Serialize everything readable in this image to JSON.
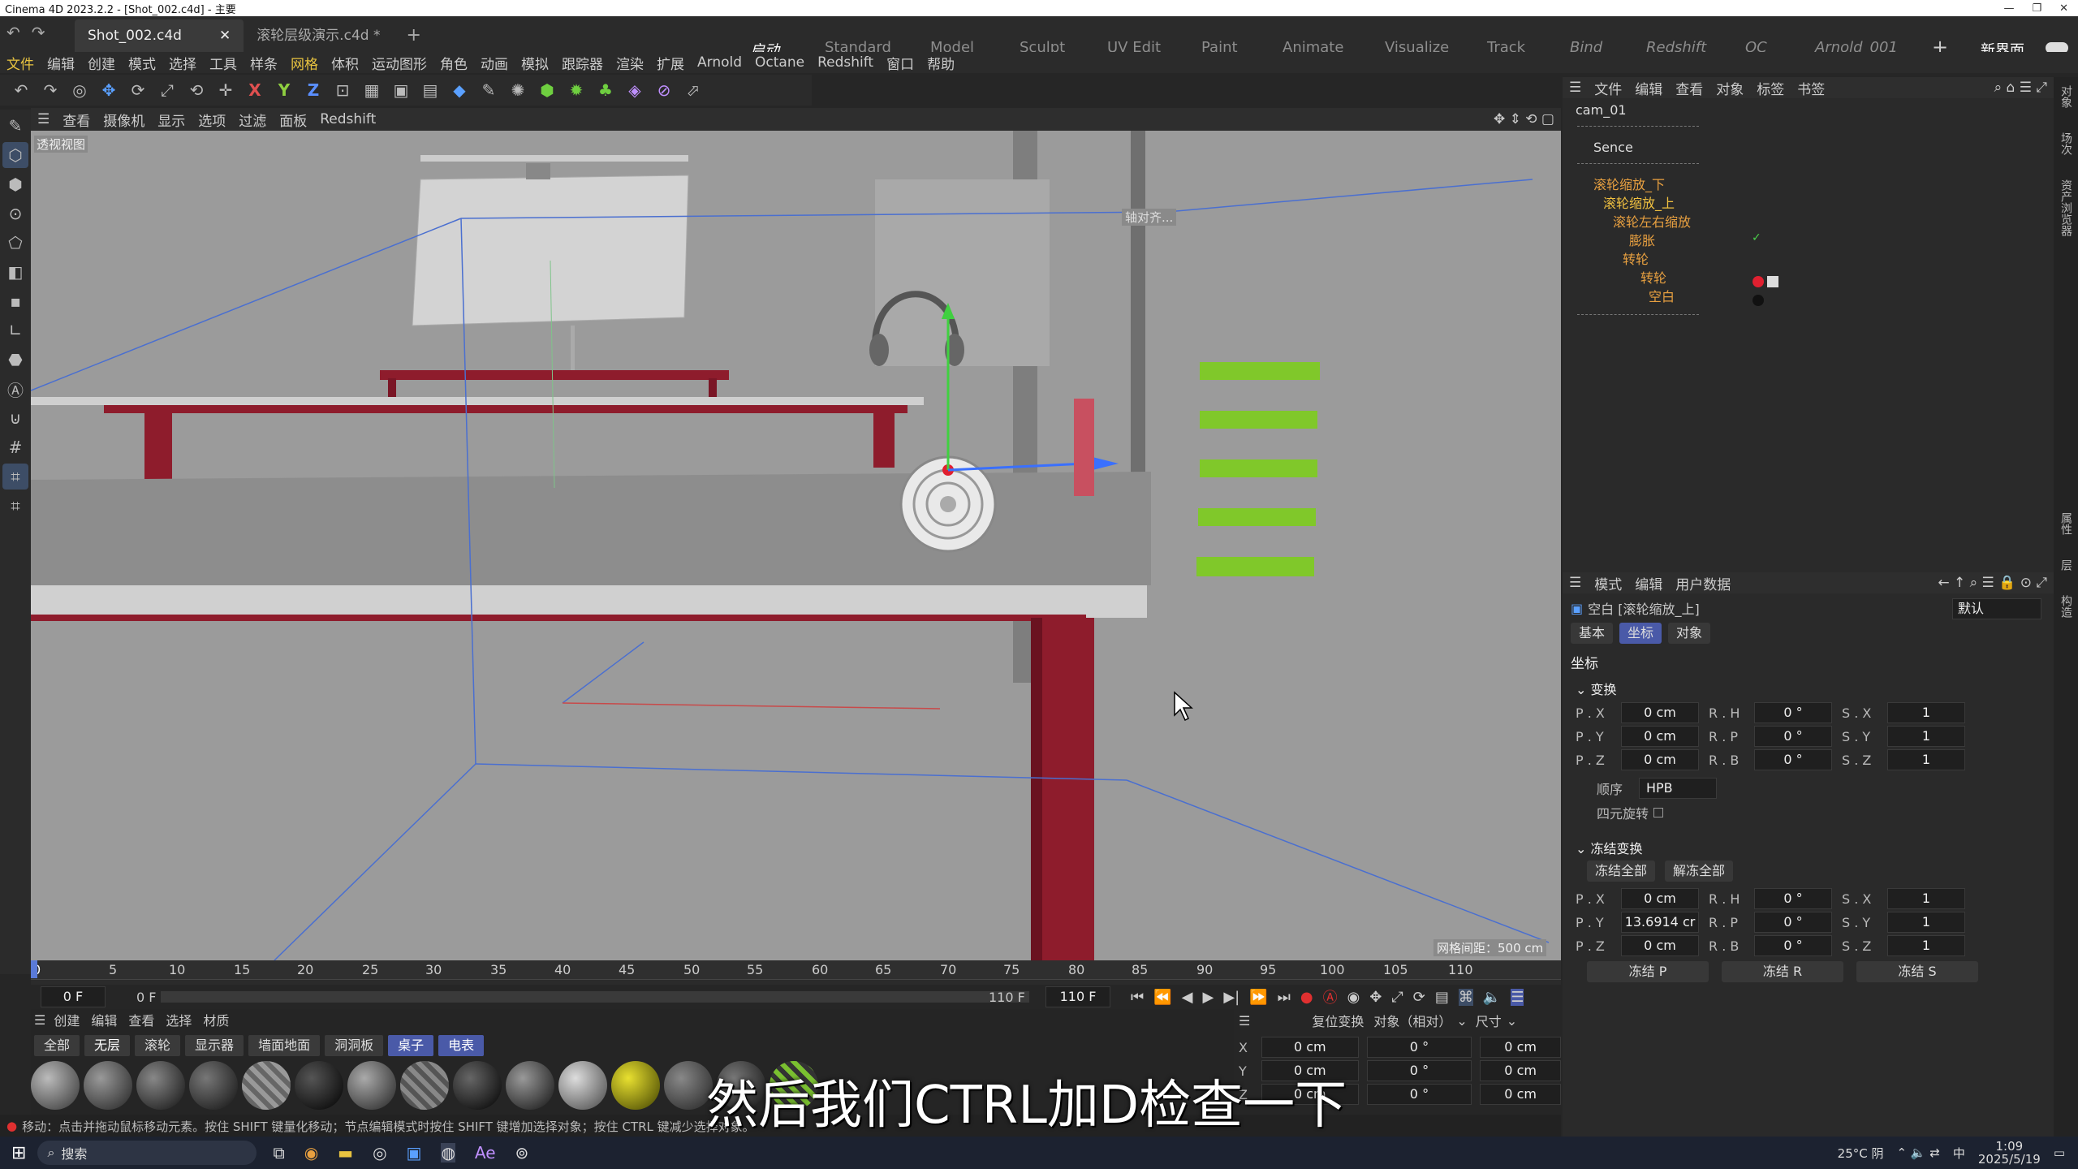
{
  "window": {
    "title": "Cinema 4D 2023.2.2 - [Shot_002.c4d] - 主要"
  },
  "tabs": [
    {
      "label": "Shot_002.c4d"
    },
    {
      "label": "滚轮层级演示.c4d *"
    }
  ],
  "new_tab": "+",
  "layouts": [
    "启动",
    "Standard",
    "Model",
    "Sculpt",
    "UV Edit",
    "Paint",
    "Animate",
    "Visualize",
    "Track",
    "Bind",
    "Redshift",
    "OC",
    "Arnold_001"
  ],
  "new_interface": "新界面",
  "menu": [
    "文件",
    "编辑",
    "创建",
    "模式",
    "选择",
    "工具",
    "样条",
    "网格",
    "体积",
    "运动图形",
    "角色",
    "动画",
    "模拟",
    "跟踪器",
    "渲染",
    "扩展",
    "Arnold",
    "Octane",
    "Redshift",
    "窗口",
    "帮助"
  ],
  "viewport_menu": [
    "查看",
    "摄像机",
    "显示",
    "选项",
    "过滤",
    "面板",
    "Redshift"
  ],
  "viewport": {
    "label": "透视视图",
    "grid_info": "网格间距：500 cm",
    "axis_tag": "轴对齐..."
  },
  "timeline": {
    "ticks": [
      "0",
      "5",
      "10",
      "15",
      "20",
      "25",
      "30",
      "35",
      "40",
      "45",
      "50",
      "55",
      "60",
      "65",
      "70",
      "75",
      "80",
      "85",
      "90",
      "95",
      "100",
      "105",
      "110"
    ],
    "current_frame": "0 F",
    "start": "0 F",
    "min": "0 F",
    "end": "110 F",
    "max": "110 F",
    "right_frame": "0 F"
  },
  "material_menu": [
    "创建",
    "编辑",
    "查看",
    "选择",
    "材质"
  ],
  "material_tabs": [
    "全部",
    "无层",
    "滚轮",
    "显示器",
    "墙面地面",
    "洞洞板",
    "桌子",
    "电表"
  ],
  "coord_panel": {
    "reset": "复位变换",
    "mode": "对象（相对）",
    "size": "尺寸",
    "rows": [
      {
        "axis": "X",
        "pos": "0 cm",
        "rot": "0 °",
        "size": "0 cm"
      },
      {
        "axis": "Y",
        "pos": "0 cm",
        "rot": "0 °",
        "size": "0 cm"
      },
      {
        "axis": "Z",
        "pos": "0 cm",
        "rot": "0 °",
        "size": "0 cm"
      }
    ]
  },
  "status": "移动：点击并拖动鼠标移动元素。按住 SHIFT 键量化移动；节点编辑模式时按住 SHIFT 键增加选择对象；按住 CTRL 键减少选择对象。",
  "subtitle": "然后我们CTRL加D检查一下",
  "object_manager": {
    "menu": [
      "文件",
      "编辑",
      "查看",
      "对象",
      "标签",
      "书签"
    ],
    "objects": [
      {
        "name": "cam_01",
        "style": "white"
      },
      {
        "name": "Sence",
        "style": "white"
      },
      {
        "name": "滚轮缩放_下",
        "style": "orange"
      },
      {
        "name": "滚轮缩放_上",
        "style": "sel"
      },
      {
        "name": "滚轮左右缩放",
        "style": "orange"
      },
      {
        "name": "膨胀",
        "style": "orange"
      },
      {
        "name": "转轮",
        "style": "orange"
      },
      {
        "name": "转轮",
        "style": "orange"
      },
      {
        "name": "空白",
        "style": "orange"
      }
    ]
  },
  "attributes": {
    "menu": [
      "模式",
      "编辑",
      "用户数据"
    ],
    "object_title": "空白 [滚轮缩放_上]",
    "preset": "默认",
    "tabs": [
      "基本",
      "坐标",
      "对象"
    ],
    "section": "坐标",
    "transform_group": "变换",
    "transform": [
      {
        "p": "P . X",
        "pv": "0 cm",
        "r": "R . H",
        "rv": "0 °",
        "s": "S . X",
        "sv": "1"
      },
      {
        "p": "P . Y",
        "pv": "0 cm",
        "r": "R . P",
        "rv": "0 °",
        "s": "S . Y",
        "sv": "1"
      },
      {
        "p": "P . Z",
        "pv": "0 cm",
        "r": "R . B",
        "rv": "0 °",
        "s": "S . Z",
        "sv": "1"
      }
    ],
    "order_label": "顺序",
    "order_value": "HPB",
    "quat_label": "四元旋转",
    "freeze_group": "冻结变换",
    "freeze_all": "冻结全部",
    "unfreeze_all": "解冻全部",
    "freeze": [
      {
        "p": "P . X",
        "pv": "0 cm",
        "r": "R . H",
        "rv": "0 °",
        "s": "S . X",
        "sv": "1"
      },
      {
        "p": "P . Y",
        "pv": "13.6914 cr",
        "r": "R . P",
        "rv": "0 °",
        "s": "S . Y",
        "sv": "1"
      },
      {
        "p": "P . Z",
        "pv": "0 cm",
        "r": "R . B",
        "rv": "0 °",
        "s": "S . Z",
        "sv": "1"
      }
    ],
    "freeze_p": "冻结 P",
    "freeze_r": "冻结 R",
    "freeze_s": "冻结 S"
  },
  "right_strip": [
    "对象",
    "场次",
    "资产浏览器",
    "属性",
    "层",
    "构造"
  ],
  "taskbar": {
    "search": "搜索",
    "weather": "25°C 阴",
    "time": "1:09",
    "date": "2025/5/19",
    "ime": "中"
  }
}
